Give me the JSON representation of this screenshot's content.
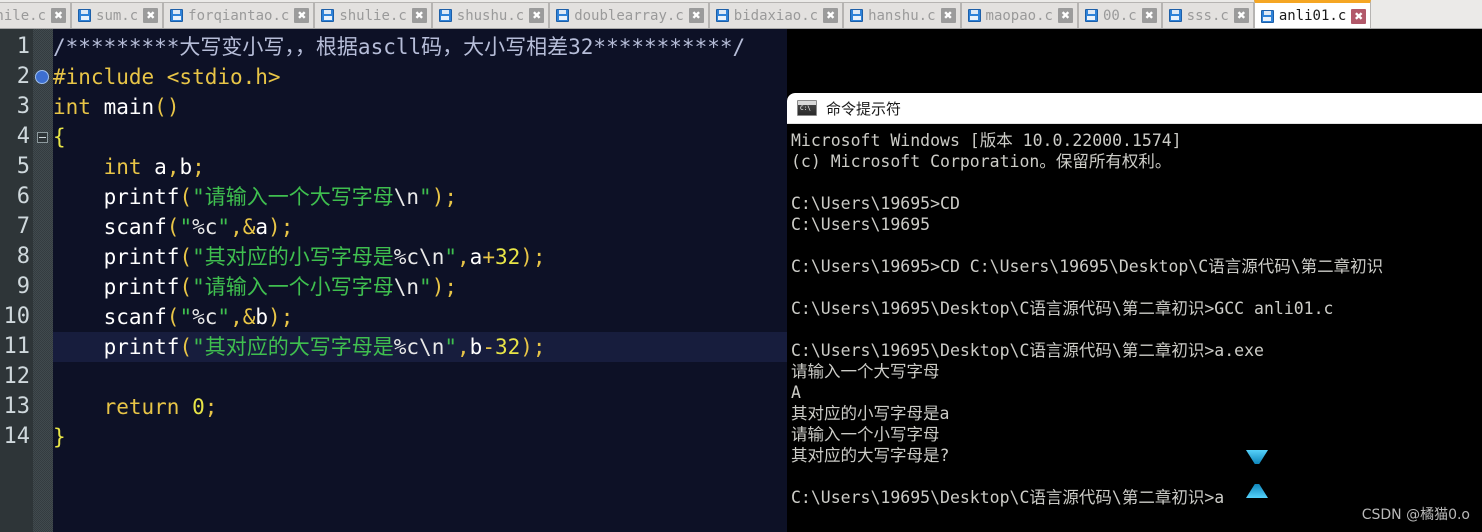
{
  "tabs": [
    {
      "label": "while.c",
      "icon": "floppy-disk-icon",
      "close": "✖",
      "active": false
    },
    {
      "label": "sum.c",
      "icon": "floppy-disk-icon",
      "close": "✖",
      "active": false
    },
    {
      "label": "forqiantao.c",
      "icon": "floppy-disk-icon",
      "close": "✖",
      "active": false
    },
    {
      "label": "shulie.c",
      "icon": "floppy-disk-icon",
      "close": "✖",
      "active": false
    },
    {
      "label": "shushu.c",
      "icon": "floppy-disk-icon",
      "close": "✖",
      "active": false
    },
    {
      "label": "doublearray.c",
      "icon": "floppy-disk-icon",
      "close": "✖",
      "active": false
    },
    {
      "label": "bidaxiao.c",
      "icon": "floppy-disk-icon",
      "close": "✖",
      "active": false
    },
    {
      "label": "hanshu.c",
      "icon": "floppy-disk-icon",
      "close": "✖",
      "active": false
    },
    {
      "label": "maopao.c",
      "icon": "floppy-disk-icon",
      "close": "✖",
      "active": false
    },
    {
      "label": "00.c",
      "icon": "floppy-disk-icon",
      "close": "✖",
      "active": false
    },
    {
      "label": "sss.c",
      "icon": "floppy-disk-icon",
      "close": "✖",
      "active": false
    },
    {
      "label": "anli01.c",
      "icon": "floppy-disk-icon",
      "close": "✖",
      "active": true
    }
  ],
  "editor": {
    "line_numbers": [
      "1",
      "2",
      "3",
      "4",
      "5",
      "6",
      "7",
      "8",
      "9",
      "10",
      "11",
      "12",
      "13",
      "14"
    ],
    "breakpoint_line": 2,
    "fold_line": 4,
    "current_line": 11,
    "lines": [
      {
        "n": "1",
        "text": "/*********大写变小写，，根据ascll码，大小写相差32***********/"
      },
      {
        "n": "2",
        "text": "#include <stdio.h>"
      },
      {
        "n": "3",
        "text": "int main()"
      },
      {
        "n": "4",
        "text": "{"
      },
      {
        "n": "5",
        "text": "    int a,b;"
      },
      {
        "n": "6",
        "text": "    printf(\"请输入一个大写字母\\n\");"
      },
      {
        "n": "7",
        "text": "    scanf(\"%c\",&a);"
      },
      {
        "n": "8",
        "text": "    printf(\"其对应的小写字母是%c\\n\",a+32);"
      },
      {
        "n": "9",
        "text": "    printf(\"请输入一个小写字母\\n\");"
      },
      {
        "n": "10",
        "text": "    scanf(\"%c\",&b);"
      },
      {
        "n": "11",
        "text": "    printf(\"其对应的大写字母是%c\\n\",b-32);"
      },
      {
        "n": "12",
        "text": ""
      },
      {
        "n": "13",
        "text": "    return 0;"
      },
      {
        "n": "14",
        "text": "}"
      }
    ]
  },
  "console": {
    "icon": "cmd-prompt-icon",
    "title": "命令提示符",
    "lines": [
      "Microsoft Windows [版本 10.0.22000.1574]",
      "(c) Microsoft Corporation。保留所有权利。",
      "",
      "C:\\Users\\19695>CD",
      "C:\\Users\\19695",
      "",
      "C:\\Users\\19695>CD C:\\Users\\19695\\Desktop\\C语言源代码\\第二章初识",
      "",
      "C:\\Users\\19695\\Desktop\\C语言源代码\\第二章初识>GCC anli01.c",
      "",
      "C:\\Users\\19695\\Desktop\\C语言源代码\\第二章初识>a.exe",
      "请输入一个大写字母",
      "A",
      "其对应的小写字母是a",
      "请输入一个小写字母",
      "其对应的大写字母是?",
      "",
      "C:\\Users\\19695\\Desktop\\C语言源代码\\第二章初识>a"
    ]
  },
  "cursor": {
    "icon": "text-select-cursor"
  },
  "watermark": "CSDN @橘猫0.o",
  "colors": {
    "editor_bg": "#0d1126",
    "gutter_bg": "#2e3538",
    "current_line_bg": "#171d3d",
    "console_bg": "#000000",
    "accent_tab": "#f5a623",
    "string": "#3fbf4f",
    "keyword": "#e8c547",
    "comment": "#b6bdd8"
  }
}
